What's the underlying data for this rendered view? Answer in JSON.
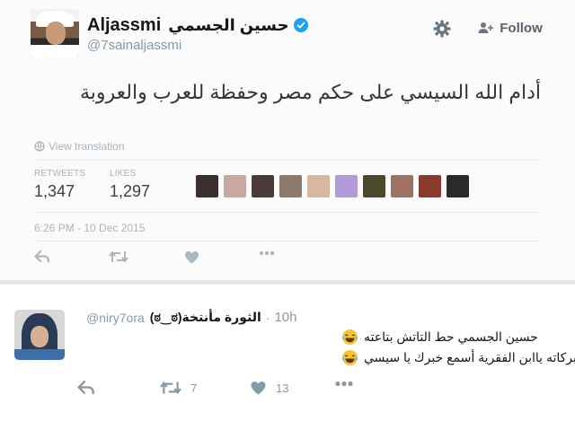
{
  "tweet": {
    "display_name_en": "Aljassmi",
    "display_name_ar": "حسين الجسمي",
    "handle": "@7sainaljassmi",
    "follow_label": "Follow",
    "text": "أدام الله السيسي على حكم مصر وحفظة للعرب والعروبة",
    "view_translation": "View translation",
    "retweets_label": "RETWEETS",
    "retweets": "1,347",
    "likes_label": "LIKES",
    "likes": "1,297",
    "timestamp": "6:26 PM - 10 Dec 2015",
    "icons": [
      "gear-icon",
      "follow-user-icon",
      "verified-icon",
      "globe-icon",
      "reply-icon",
      "retweet-icon",
      "heart-icon",
      "more-icon"
    ],
    "liker_colors": [
      "#3a3030",
      "#c7a9a0",
      "#4a3a3a",
      "#8a7a6a",
      "#d4b8a0",
      "#b39ad8",
      "#4a4a2a",
      "#a07060",
      "#8a3a2a",
      "#2a2a2a"
    ]
  },
  "reply": {
    "handle": "@niry7ora",
    "name": "الثورة مأنتخة(ಠ‿ಠ)",
    "time": "10h",
    "line1": "حسين الجسمي حط التاتش بتاعته",
    "line2": "بركاته ياابن الفقرية أسمع خبرك يا سيسي",
    "retweet_count": "7",
    "like_count": "13",
    "icons": [
      "emoji-laughing-icon",
      "reply-icon",
      "retweet-icon",
      "heart-icon",
      "more-icon"
    ]
  },
  "colors": {
    "secondary_text": "#8899a6",
    "primary_text": "#14171a",
    "verified": "#1da1f2"
  }
}
